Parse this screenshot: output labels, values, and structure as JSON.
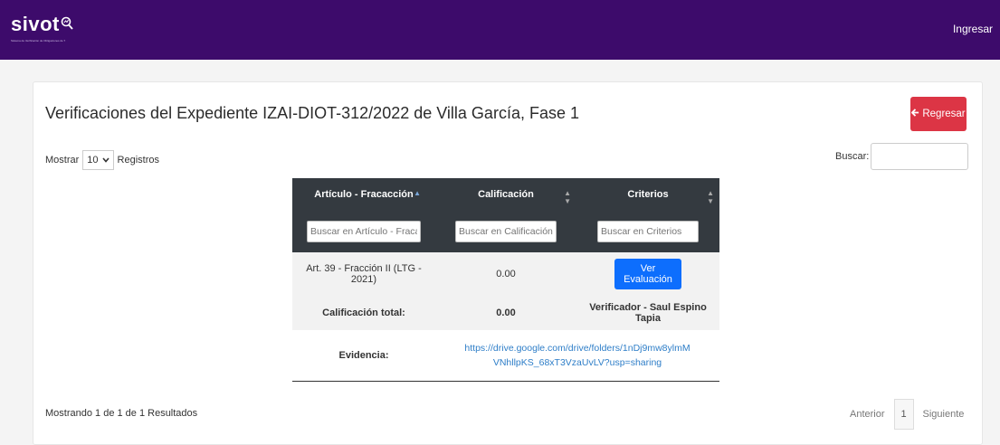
{
  "header": {
    "logo_text": "sivot",
    "logo_subtitle": "Sistema de Verificación de Obligaciones de Transparencia",
    "login_label": "Ingresar",
    "brand_color": "#3d0b6b"
  },
  "page": {
    "title": "Verificaciones del Expediente IZAI-DIOT-312/2022 de Villa García, Fase 1",
    "back_label": "Regresar",
    "back_icon": "arrow-left-icon"
  },
  "controls": {
    "show_label": "Mostrar",
    "show_value": "10",
    "records_label": "Registros",
    "search_label": "Buscar:"
  },
  "table": {
    "columns": [
      "Artículo - Fracacción",
      "Calificación",
      "Criterios"
    ],
    "filters": [
      "Buscar en Artículo - Fracacción",
      "Buscar en Calificación",
      "Buscar en Criterios"
    ],
    "rows": [
      {
        "articulo": "Art. 39 - Fracción II (LTG - 2021)",
        "calificacion": "0.00",
        "action": "Ver Evaluación"
      }
    ],
    "total": {
      "label": "Calificación total:",
      "value": "0.00",
      "verifier": "Verificador - Saul Espino Tapia"
    },
    "evidence": {
      "label": "Evidencia:",
      "link": "https://drive.google.com/drive/folders/1nDj9mw8ylmMVNhllpKS_68xT3VzaUvLV?usp=sharing"
    }
  },
  "footer": {
    "info": "Mostrando 1 de 1 de 1 Resultados",
    "prev": "Anterior",
    "page": "1",
    "next": "Siguiente"
  }
}
